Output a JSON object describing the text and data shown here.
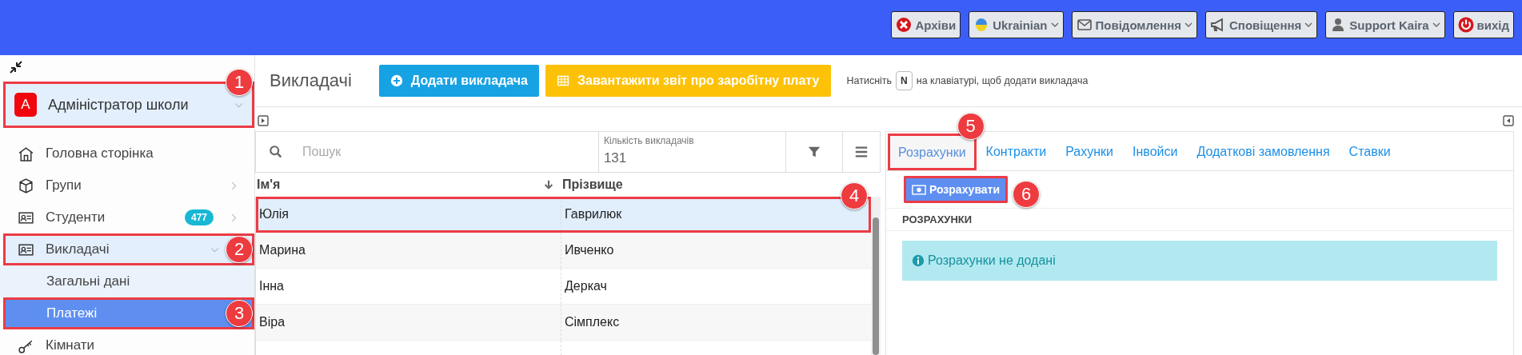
{
  "topbar": {
    "buttons": [
      {
        "kind": "archive",
        "label": "Архіви",
        "dropdown": false
      },
      {
        "kind": "language",
        "label": "Ukrainian",
        "dropdown": true
      },
      {
        "kind": "messages",
        "label": "Повідомлення",
        "dropdown": true
      },
      {
        "kind": "notifications",
        "label": "Сповіщення",
        "dropdown": true
      },
      {
        "kind": "user",
        "label": "Support Kaira",
        "dropdown": true
      },
      {
        "kind": "logout",
        "label": "вихід",
        "dropdown": false
      }
    ]
  },
  "sidebar": {
    "header": {
      "avatar": "A",
      "title": "Адміністратор школи",
      "callout": "1"
    },
    "items": [
      {
        "kind": "link",
        "label": "Головна сторінка",
        "expanded": false
      },
      {
        "kind": "group",
        "label": "Групи",
        "expanded": false
      },
      {
        "kind": "group",
        "label": "Студенти",
        "badge": "477",
        "expanded": false
      },
      {
        "kind": "group",
        "label": "Викладачі",
        "expanded": true,
        "callout": "2",
        "children": [
          {
            "label": "Загальні дані",
            "selected": false
          },
          {
            "label": "Платежі",
            "selected": true,
            "callout": "3"
          }
        ]
      },
      {
        "kind": "link",
        "label": "Кімнати",
        "expanded": false
      }
    ]
  },
  "page": {
    "title": "Викладачі",
    "add_button": "Додати викладача",
    "report_button": "Завантажити звіт про заробітну плату",
    "hint": {
      "before": "Натисніть",
      "key": "N",
      "after": "на клавіатурі, щоб додати викладача"
    }
  },
  "table": {
    "search": {
      "placeholder": "Пошук"
    },
    "count_label": "Кількість викладачів",
    "count": "131",
    "columns": [
      {
        "label": "Ім'я",
        "sorted": true
      },
      {
        "label": "Прізвище",
        "sorted": false
      }
    ],
    "rows": [
      {
        "first_name": "Юлія",
        "last_name": "Гаврилюк",
        "selected": true,
        "callout": "4"
      },
      {
        "first_name": "Марина",
        "last_name": "Ивченко",
        "selected": false
      },
      {
        "first_name": "Інна",
        "last_name": "Деркач",
        "selected": false
      },
      {
        "first_name": "Віра",
        "last_name": "Сімплекс",
        "selected": false
      }
    ]
  },
  "details": {
    "tabs": [
      {
        "label": "Розрахунки",
        "selected": true,
        "callout": "5"
      },
      {
        "label": "Контракти",
        "selected": false
      },
      {
        "label": "Рахунки",
        "selected": false
      },
      {
        "label": "Інвойси",
        "selected": false
      },
      {
        "label": "Додаткові замовлення",
        "selected": false
      },
      {
        "label": "Ставки",
        "selected": false
      }
    ],
    "calculate_button": {
      "label": "Розрахувати",
      "callout": "6"
    },
    "section_title": "РОЗРАХУНКИ",
    "alert": "Розрахунки не додані"
  }
}
